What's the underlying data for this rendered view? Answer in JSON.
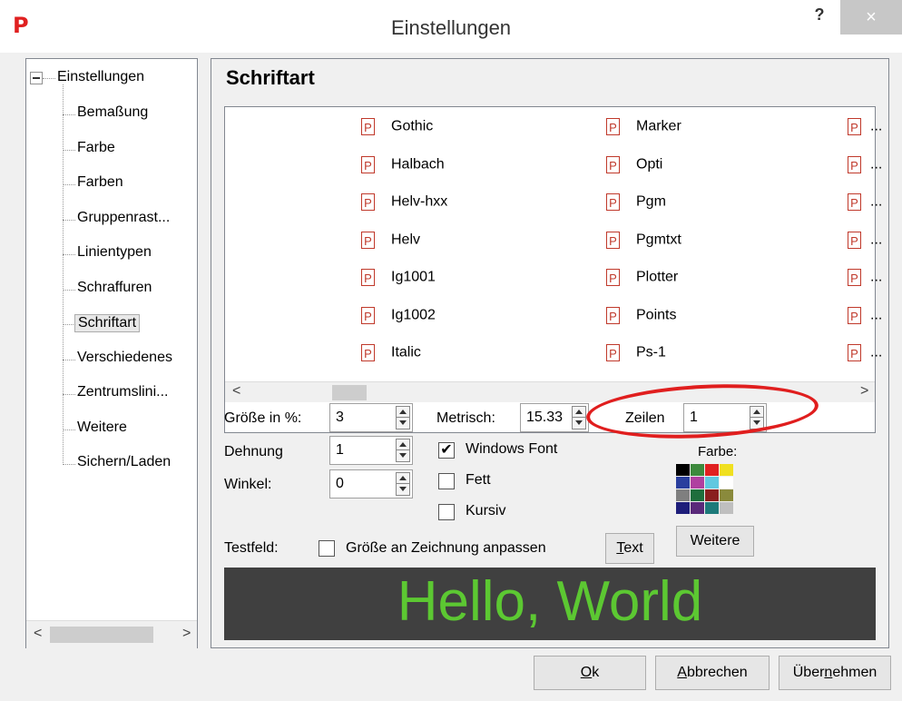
{
  "window": {
    "app_icon_letter": "P",
    "title": "Einstellungen",
    "help_label": "?",
    "close_label": "×"
  },
  "tree": {
    "root": "Einstellungen",
    "items": [
      "Bemaßung",
      "Farbe",
      "Farben",
      "Gruppenrast...",
      "Linientypen",
      "Schraffuren",
      "Schriftart",
      "Verschiedenes",
      "Zentrumslini...",
      "Weitere",
      "Sichern/Laden"
    ],
    "selected_index": 6
  },
  "content": {
    "section_title": "Schriftart",
    "font_icon_glyph": "P",
    "fonts_col1": [
      "Gothic",
      "Halbach",
      "Helv-hxx",
      "Helv",
      "Ig1001",
      "Ig1002",
      "Italic"
    ],
    "fonts_col2": [
      "Marker",
      "Opti",
      "Pgm",
      "Pgmtxt",
      "Plotter",
      "Points",
      "Ps-1"
    ],
    "fonts_col3": [
      "...",
      "...",
      "...",
      "...",
      "...",
      "...",
      "..."
    ],
    "size_label": "Größe in %:",
    "size_value": "3",
    "stretch_label": "Dehnung",
    "stretch_value": "1",
    "angle_label": "Winkel:",
    "angle_value": "0",
    "metric_label": "Metrisch:",
    "metric_value": "15.33",
    "lines_label": "Zeilen",
    "lines_value": "1",
    "windows_font_label": "Windows Font",
    "windows_font_checked": true,
    "bold_label": "Fett",
    "italic_label": "Kursiv",
    "color_label": "Farbe:",
    "more_button": "Weitere",
    "testfield_label": "Testfeld:",
    "fit_drawing_label": "Größe an Zeichnung anpassen",
    "text_button_u": "T",
    "text_button_rest": "ext",
    "preview_text": "Hello, World",
    "palette": [
      "#000000",
      "#3d8a3d",
      "#e02020",
      "#f0e020",
      "#2a3f9e",
      "#b040a0",
      "#60c8e0",
      "#ffffff",
      "#7f7f7f",
      "#1e6e3c",
      "#8a1e1e",
      "#8a8a3c",
      "#1e1e7a",
      "#5a2a7a",
      "#1e7a7a",
      "#bfbfbf"
    ],
    "preview_color": "#5cc832"
  },
  "buttons": {
    "ok_u": "O",
    "ok_rest": "k",
    "cancel_u": "A",
    "cancel_rest": "bbrechen",
    "apply_pre": "Über",
    "apply_u": "n",
    "apply_post": "ehmen"
  }
}
